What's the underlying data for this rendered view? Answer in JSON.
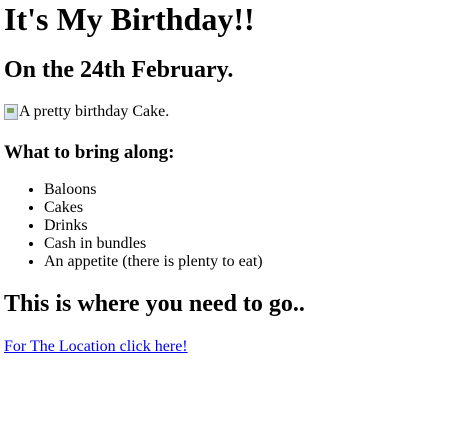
{
  "header": {
    "title": "It's My Birthday!!",
    "date": "On the 24th February."
  },
  "image": {
    "alt": "A pretty birthday Cake.",
    "icon": "broken-image-icon"
  },
  "bring": {
    "heading": "What to bring along:",
    "items": [
      "Baloons",
      "Cakes",
      "Drinks",
      "Cash in bundles",
      "An appetite (there is plenty to eat)"
    ]
  },
  "location": {
    "heading": "This is where you need to go..",
    "link_text": "For The Location click here!"
  },
  "colors": {
    "link": "#0000ee",
    "text": "#000000",
    "background": "#ffffff"
  }
}
